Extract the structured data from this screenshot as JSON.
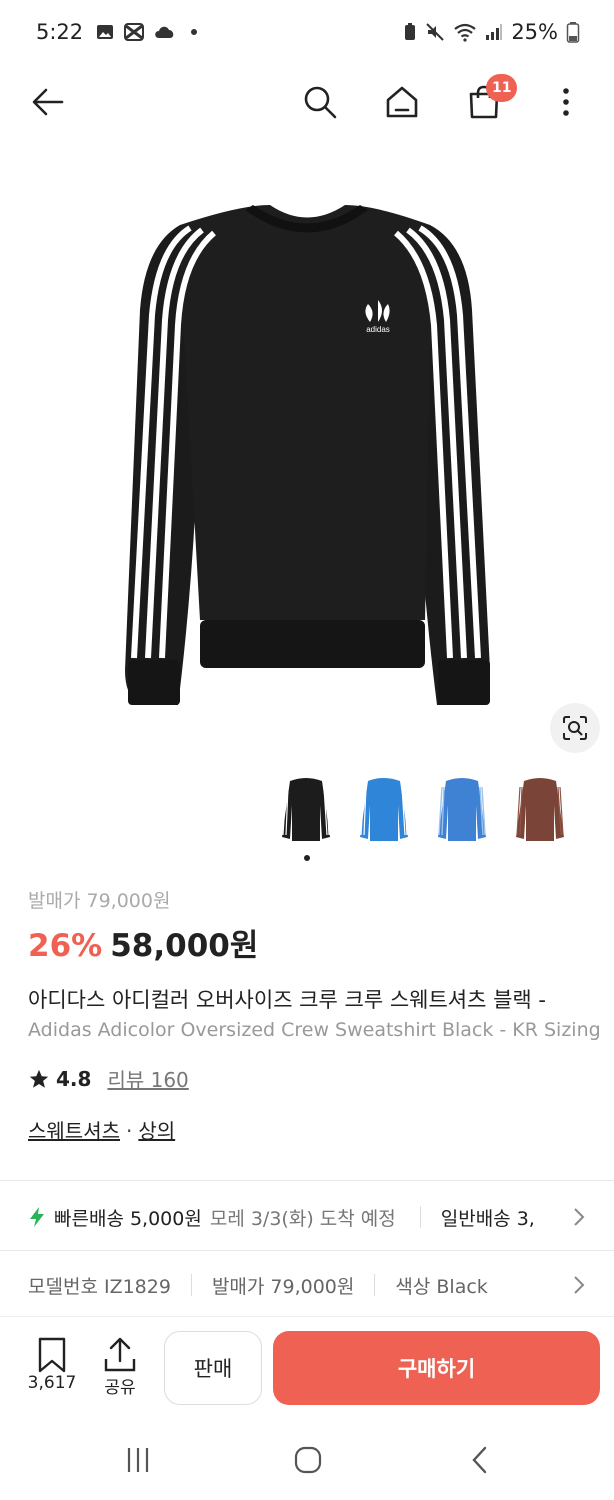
{
  "status": {
    "time": "5:22",
    "battery": "25%"
  },
  "nav": {
    "cart_count": "11"
  },
  "product": {
    "retail_label": "발매가 79,000원",
    "discount": "26%",
    "price": "58,000원",
    "title_ko": "아디다스 아디컬러 오버사이즈 크루 크루 스웨트셔츠 블랙 - ",
    "title_en": "Adidas Adicolor Oversized Crew Sweatshirt Black - KR Sizing",
    "rating": "4.8",
    "reviews": "리뷰 160",
    "category_1": "스웨트셔츠",
    "category_sep": "·",
    "category_2": "상의",
    "image_logo": "adidas"
  },
  "shipping": {
    "fast_label": "빠른배송 5,000원",
    "fast_eta": "모레 3/3(화) 도착 예정",
    "normal_label": "일반배송 3,"
  },
  "meta": {
    "model": "모델번호 IZ1829",
    "retail": "발매가 79,000원",
    "color": "색상 Black"
  },
  "actions": {
    "save_count": "3,617",
    "share_label": "공유",
    "sell_label": "판매",
    "buy_label": "구매하기"
  },
  "colors": {
    "accent": "#ef6253",
    "thumb_colors": [
      "#1c1c1c",
      "#2f86d8",
      "#3f82d4",
      "#7a4538"
    ]
  }
}
